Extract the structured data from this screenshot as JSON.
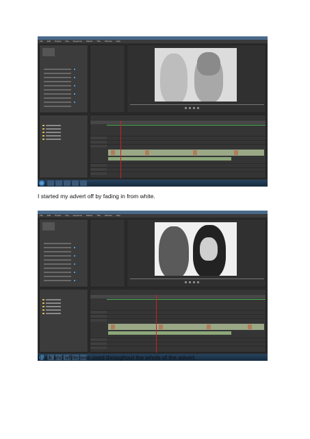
{
  "document": {
    "captions": [
      "I started my advert off by fading in from white.",
      "Black and white was used throughout the whole of the advert."
    ]
  },
  "screenshots": [
    {
      "app": "Adobe Premiere Pro",
      "menu": [
        "File",
        "Edit",
        "Project",
        "Clip",
        "Sequence",
        "Marker",
        "Title",
        "Window",
        "Help"
      ],
      "frame_tone": "#dcdcdc",
      "playhead_fraction": 0.07
    },
    {
      "app": "Adobe Premiere Pro",
      "menu": [
        "File",
        "Edit",
        "Project",
        "Clip",
        "Sequence",
        "Marker",
        "Title",
        "Window",
        "Help"
      ],
      "frame_tone": "#f0f0f0",
      "playhead_fraction": 0.28
    }
  ],
  "colors": {
    "clip_video": "#9aa886",
    "clip_audio": "#8ca77a",
    "playhead": "#cc2222"
  }
}
